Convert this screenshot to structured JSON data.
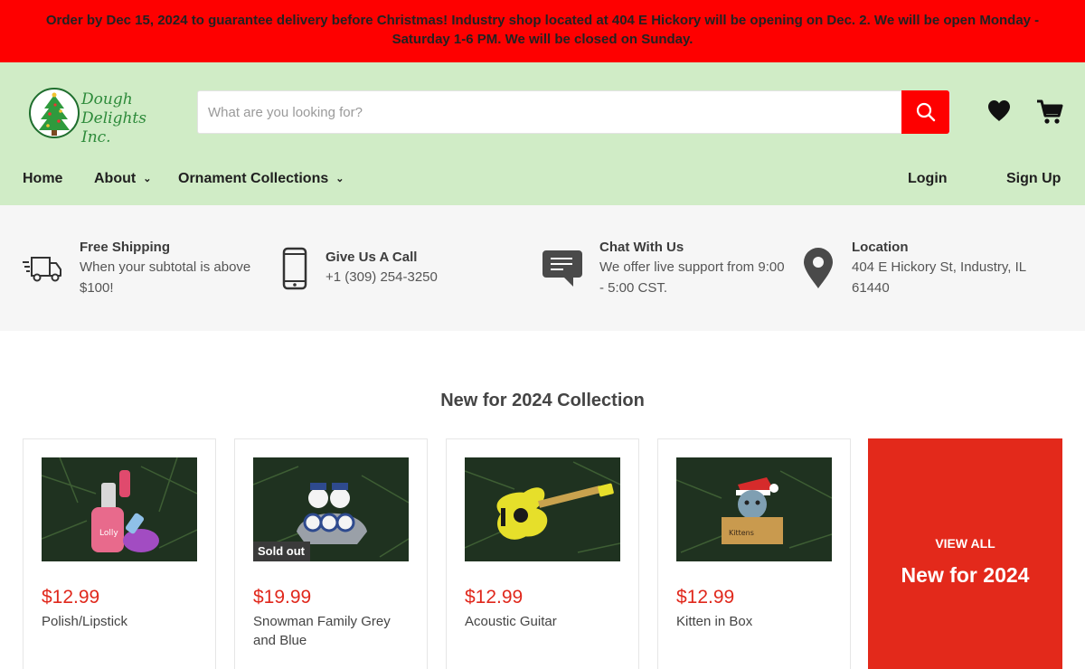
{
  "announcement": "Order by Dec 15, 2024 to guarantee delivery before Christmas! Industry shop located at 404 E Hickory will be opening on Dec. 2. We will be open Monday - Saturday 1-6 PM. We will be closed on Sunday.",
  "logo": {
    "line1": "Dough",
    "line2": "Delights Inc."
  },
  "search": {
    "placeholder": "What are you looking for?",
    "icon": "search-icon"
  },
  "header_icons": {
    "wishlist": "heart-icon",
    "cart": "cart-icon"
  },
  "nav": {
    "home": "Home",
    "about": "About",
    "collections": "Ornament Collections",
    "login": "Login",
    "signup": "Sign Up"
  },
  "features": [
    {
      "icon": "truck-icon",
      "title": "Free Shipping",
      "text": "When your subtotal is above $100!"
    },
    {
      "icon": "phone-icon",
      "title": "Give Us A Call",
      "text": "+1 (309) 254-3250"
    },
    {
      "icon": "chat-icon",
      "title": "Chat With Us",
      "text": "We offer live support from 9:00 - 5:00 CST."
    },
    {
      "icon": "map-pin-icon",
      "title": "Location",
      "text": "404 E Hickory St, Industry, IL 61440"
    }
  ],
  "section_title": "New for 2024 Collection",
  "products": [
    {
      "price": "$12.99",
      "name": "Polish/Lipstick",
      "badge": ""
    },
    {
      "price": "$19.99",
      "name": "Snowman Family Grey and Blue",
      "badge": "Sold out"
    },
    {
      "price": "$12.99",
      "name": "Acoustic Guitar",
      "badge": ""
    },
    {
      "price": "$12.99",
      "name": "Kitten in Box",
      "badge": ""
    }
  ],
  "view_all": {
    "small": "VIEW ALL",
    "big": "New for 2024"
  },
  "colors": {
    "banner": "#fe0000",
    "header_bg": "#d0ecc6",
    "accent": "#e3291b",
    "price": "#e0281c"
  }
}
